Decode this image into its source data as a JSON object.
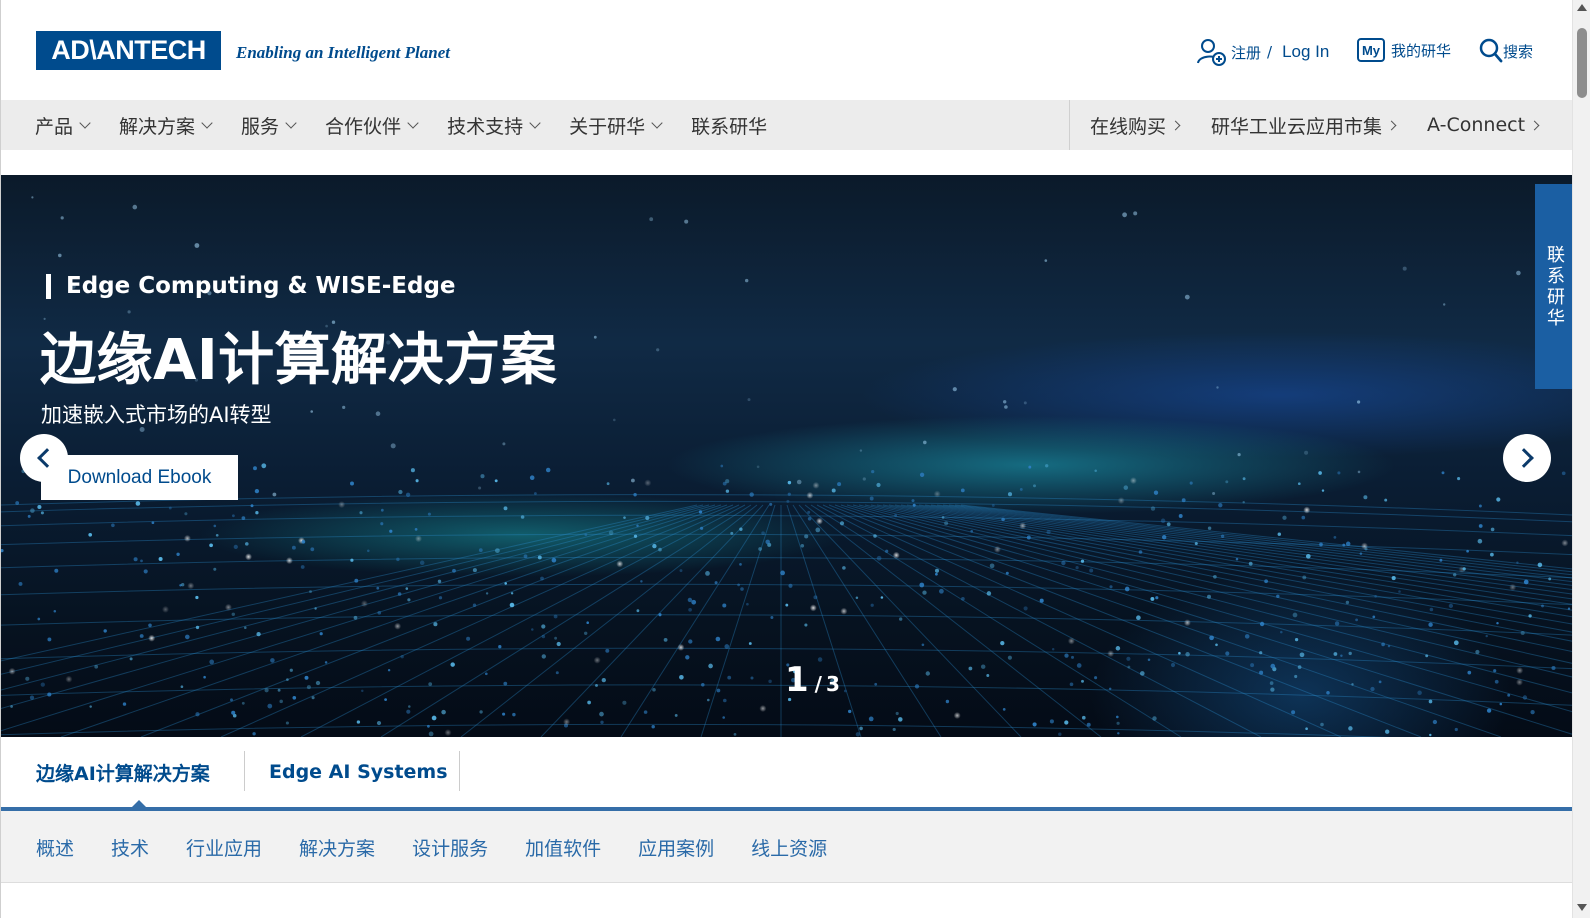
{
  "header": {
    "logo": "AD\\ANTECH",
    "tagline": "Enabling an Intelligent Planet",
    "register": "注册",
    "slash": "/",
    "login": "Log In",
    "my_badge": "My",
    "my_advantech": "我的研华",
    "search": "搜索"
  },
  "nav": {
    "left": [
      {
        "label": "产品",
        "dropdown": true
      },
      {
        "label": "解决方案",
        "dropdown": true
      },
      {
        "label": "服务",
        "dropdown": true
      },
      {
        "label": "合作伙伴",
        "dropdown": true
      },
      {
        "label": "技术支持",
        "dropdown": true
      },
      {
        "label": "关于研华",
        "dropdown": true
      },
      {
        "label": "联系研华",
        "dropdown": false
      }
    ],
    "right": [
      {
        "label": "在线购买"
      },
      {
        "label": "研华工业云应用市集"
      },
      {
        "label": "A-Connect"
      }
    ]
  },
  "hero": {
    "kicker": "Edge Computing & WISE-Edge",
    "title": "边缘AI计算解决方案",
    "subtitle": "加速嵌入式市场的AI转型",
    "button": "Download Ebook",
    "page_current": "1",
    "page_sep": "/",
    "page_total": "3"
  },
  "side_tab": "联系研华",
  "tabs": [
    {
      "label": "边缘AI计算解决方案",
      "active": true
    },
    {
      "label": "Edge AI Systems",
      "active": false
    }
  ],
  "subnav": [
    "概述",
    "技术",
    "行业应用",
    "解决方案",
    "设计服务",
    "加值软件",
    "应用案例",
    "线上资源"
  ],
  "colors": {
    "brand": "#004B8D",
    "accent": "#356ea8",
    "side_tab": "#1b5fa3"
  }
}
